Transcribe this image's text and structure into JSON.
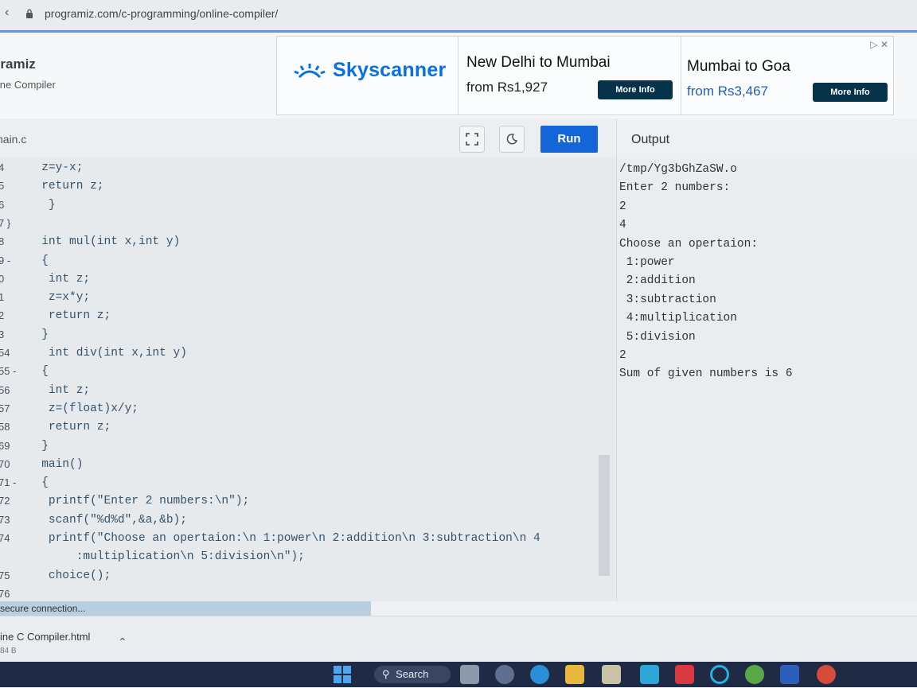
{
  "browser": {
    "url": "programiz.com/c-programming/online-compiler/"
  },
  "site": {
    "brand": "gramiz",
    "subtitle": "line Compiler"
  },
  "ad": {
    "brand": "Skyscanner",
    "deals": [
      {
        "route": "New Delhi to Mumbai",
        "price": "from Rs1,927",
        "button": "More Info"
      },
      {
        "route": "Mumbai to Goa",
        "price": "from Rs3,467",
        "button": "More Info"
      }
    ],
    "colors": {
      "brand": "#0770e3",
      "price_link": "#1f5fbf",
      "button": "#063349"
    }
  },
  "toolbar": {
    "filename": "nain.c",
    "run_label": "Run",
    "fullscreen_icon": "fullscreen-icon",
    "theme_icon": "moon-icon"
  },
  "output": {
    "title": "Output",
    "lines": [
      "/tmp/Yg3bGhZaSW.o",
      "Enter 2 numbers:",
      "2",
      "4",
      "Choose an opertaion:",
      " 1:power",
      " 2:addition",
      " 3:subtraction",
      " 4:multiplication",
      " 5:division",
      "2",
      "Sum of given numbers is 6"
    ]
  },
  "code": {
    "lines": [
      {
        "num": "4",
        "text": "z=y-x;",
        "indent": 6
      },
      {
        "num": "5",
        "text": "return z;",
        "indent": 6
      },
      {
        "num": "6",
        "text": "}",
        "indent": 7
      },
      {
        "num": "7 }",
        "text": "",
        "indent": 0
      },
      {
        "num": "8",
        "text": "int mul(int x,int y)",
        "indent": 6
      },
      {
        "num": "9 -",
        "text": "{",
        "indent": 6
      },
      {
        "num": "0",
        "text": "int z;",
        "indent": 7
      },
      {
        "num": "1",
        "text": "z=x*y;",
        "indent": 7
      },
      {
        "num": "2",
        "text": "return z;",
        "indent": 7
      },
      {
        "num": "3",
        "text": "}",
        "indent": 6
      },
      {
        "num": "54",
        "text": "int div(int x,int y)",
        "indent": 7
      },
      {
        "num": "55 -",
        "text": "{",
        "indent": 6
      },
      {
        "num": "56",
        "text": "int z;",
        "indent": 7
      },
      {
        "num": "57",
        "text": "z=(float)x/y;",
        "indent": 7
      },
      {
        "num": "58",
        "text": "return z;",
        "indent": 7
      },
      {
        "num": "69",
        "text": "}",
        "indent": 6
      },
      {
        "num": "70",
        "text": "main()",
        "indent": 6
      },
      {
        "num": "71 -",
        "text": "{",
        "indent": 6
      },
      {
        "num": "72",
        "text": "printf(\"Enter 2 numbers:\\n\");",
        "indent": 7
      },
      {
        "num": "73",
        "text": "scanf(\"%d%d\",&a,&b);",
        "indent": 7
      },
      {
        "num": "74",
        "text": "printf(\"Choose an opertaion:\\n 1:power\\n 2:addition\\n 3:subtraction\\n 4",
        "indent": 7
      },
      {
        "num": "",
        "text": ":multiplication\\n 5:division\\n\");",
        "indent": 11
      },
      {
        "num": "75",
        "text": "choice();",
        "indent": 7
      },
      {
        "num": "76",
        "text": "",
        "indent": 0
      }
    ]
  },
  "status": {
    "text": "secure connection..."
  },
  "download": {
    "name": "ine C Compiler.html",
    "size": "84 B"
  },
  "taskbar": {
    "search_label": "Search"
  }
}
